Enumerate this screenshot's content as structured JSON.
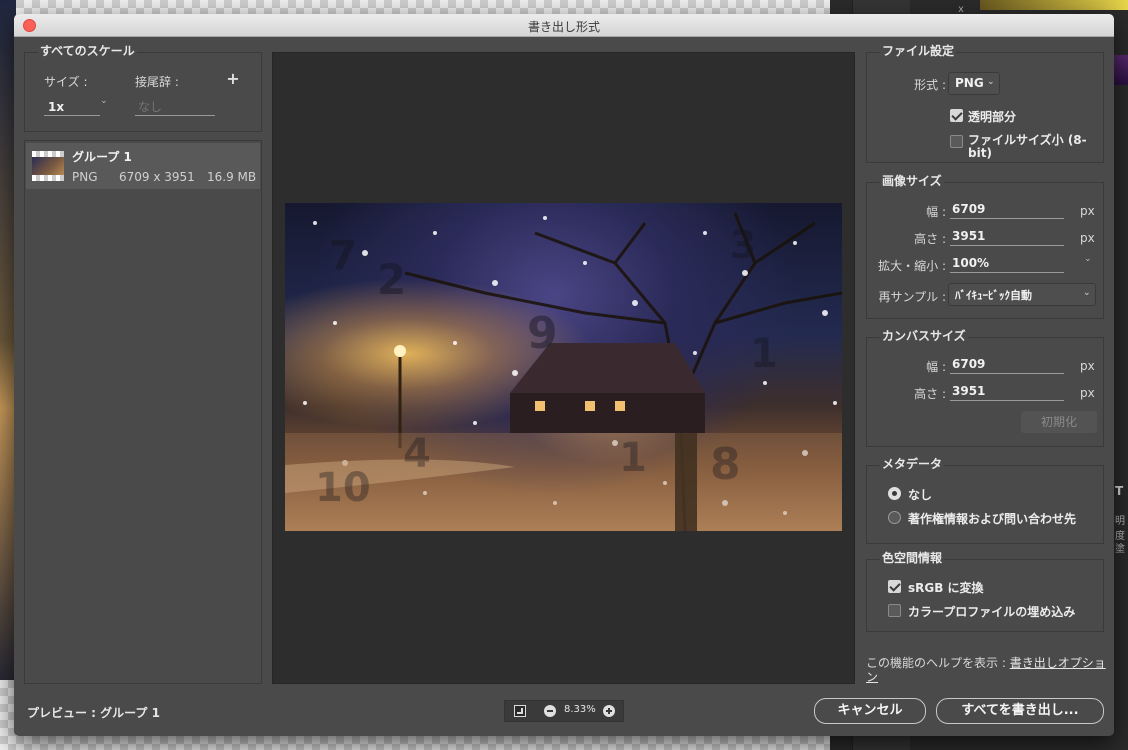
{
  "window": {
    "title": "書き出し形式"
  },
  "scales_section": {
    "title": "すべてのスケール",
    "size_label": "サイズ :",
    "suffix_label": "接尾辞 :",
    "add_icon": "plus-icon",
    "add_symbol": "+",
    "scale_value": "1x",
    "suffix_placeholder": "なし"
  },
  "assets": [
    {
      "name": "グループ 1",
      "format": "PNG",
      "dimensions": "6709 x 3951",
      "filesize": "16.9 MB"
    }
  ],
  "preview": {
    "label": "プレビュー : グループ 1",
    "zoom": "8.33%",
    "zoom_out_icon": "minus-icon",
    "zoom_in_icon": "plus-icon",
    "fit_icon": "fit-screen-icon",
    "watermark_digits": [
      "7",
      "2",
      "3",
      "9",
      "1",
      "4",
      "1",
      "8",
      "10"
    ]
  },
  "file_settings": {
    "title": "ファイル設定",
    "format_label": "形式 :",
    "format_value": "PNG",
    "transparency_label": "透明部分",
    "transparency_checked": true,
    "smaller_file_label": "ファイルサイズ小 (8-bit)",
    "smaller_file_checked": false
  },
  "image_size": {
    "title": "画像サイズ",
    "width_label": "幅 :",
    "width_value": "6709",
    "height_label": "高さ :",
    "height_value": "3951",
    "scale_label": "拡大・縮小 :",
    "scale_value": "100%",
    "resample_label": "再サンプル :",
    "resample_value": "ﾊﾞｲｷｭｰﾋﾞｯｸ自動",
    "unit": "px"
  },
  "canvas_size": {
    "title": "カンバスサイズ",
    "width_label": "幅 :",
    "width_value": "6709",
    "height_label": "高さ :",
    "height_value": "3951",
    "unit": "px",
    "reset_label": "初期化"
  },
  "metadata": {
    "title": "メタデータ",
    "option_none": "なし",
    "option_copyright": "著作権情報および問い合わせ先",
    "selected": "なし"
  },
  "color_space": {
    "title": "色空間情報",
    "srgb_label": "sRGB に変換",
    "srgb_checked": true,
    "embed_profile_label": "カラープロファイルの埋め込み",
    "embed_profile_checked": false
  },
  "help": {
    "prefix": "この機能のヘルプを表示 : ",
    "link": "書き出しオプション"
  },
  "buttons": {
    "cancel": "キャンセル",
    "export_all": "すべてを書き出し..."
  },
  "background_app": {
    "label_x": "x",
    "label_t": "T",
    "label_opacity": "明度",
    "label_fill": "塗"
  },
  "colors": {
    "dialog_bg": "#4a4a4a",
    "preview_bg": "#2d2d2d",
    "close_button": "#fc5f57",
    "accent_yellow": "#e8d64a"
  }
}
